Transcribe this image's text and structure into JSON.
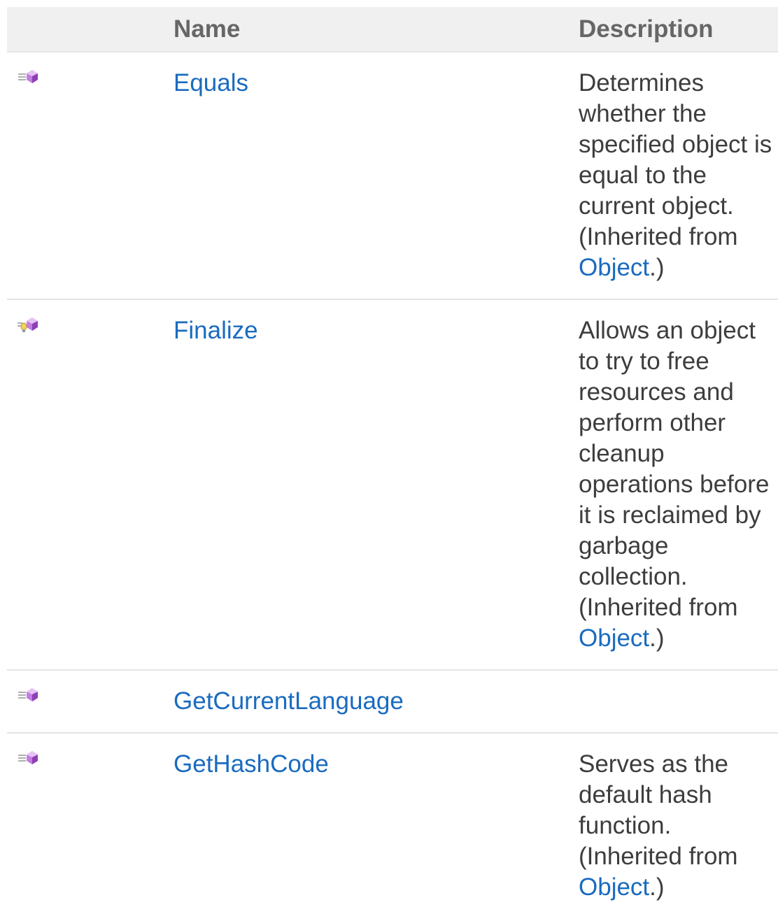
{
  "table": {
    "headers": {
      "icon": "",
      "name": "Name",
      "description": "Description"
    },
    "rows": [
      {
        "icon": "public-method-icon",
        "name": "Equals",
        "description": "Determines whether the specified object is equal to the current object.",
        "inherited_prefix": "(Inherited from",
        "inherited_link": "Object",
        "inherited_suffix": ".)"
      },
      {
        "icon": "protected-method-icon",
        "name": "Finalize",
        "description": "Allows an object to try to free resources and perform other cleanup operations before it is reclaimed by garbage collection.",
        "inherited_prefix": "(Inherited from",
        "inherited_link": "Object",
        "inherited_suffix": ".)"
      },
      {
        "icon": "public-method-icon",
        "name": "GetCurrentLanguage",
        "description": "",
        "inherited_prefix": "",
        "inherited_link": "",
        "inherited_suffix": ""
      },
      {
        "icon": "public-method-icon",
        "name": "GetHashCode",
        "description": "Serves as the default hash function.",
        "inherited_prefix": "(Inherited from",
        "inherited_link": "Object",
        "inherited_suffix": ".)"
      }
    ]
  },
  "colors": {
    "link": "#1a6bbf",
    "header_bg": "#f0f0f0",
    "header_text": "#666666",
    "body_text": "#3d3d3d",
    "divider": "#e4e4e4",
    "method_icon": "#b36ad9"
  }
}
